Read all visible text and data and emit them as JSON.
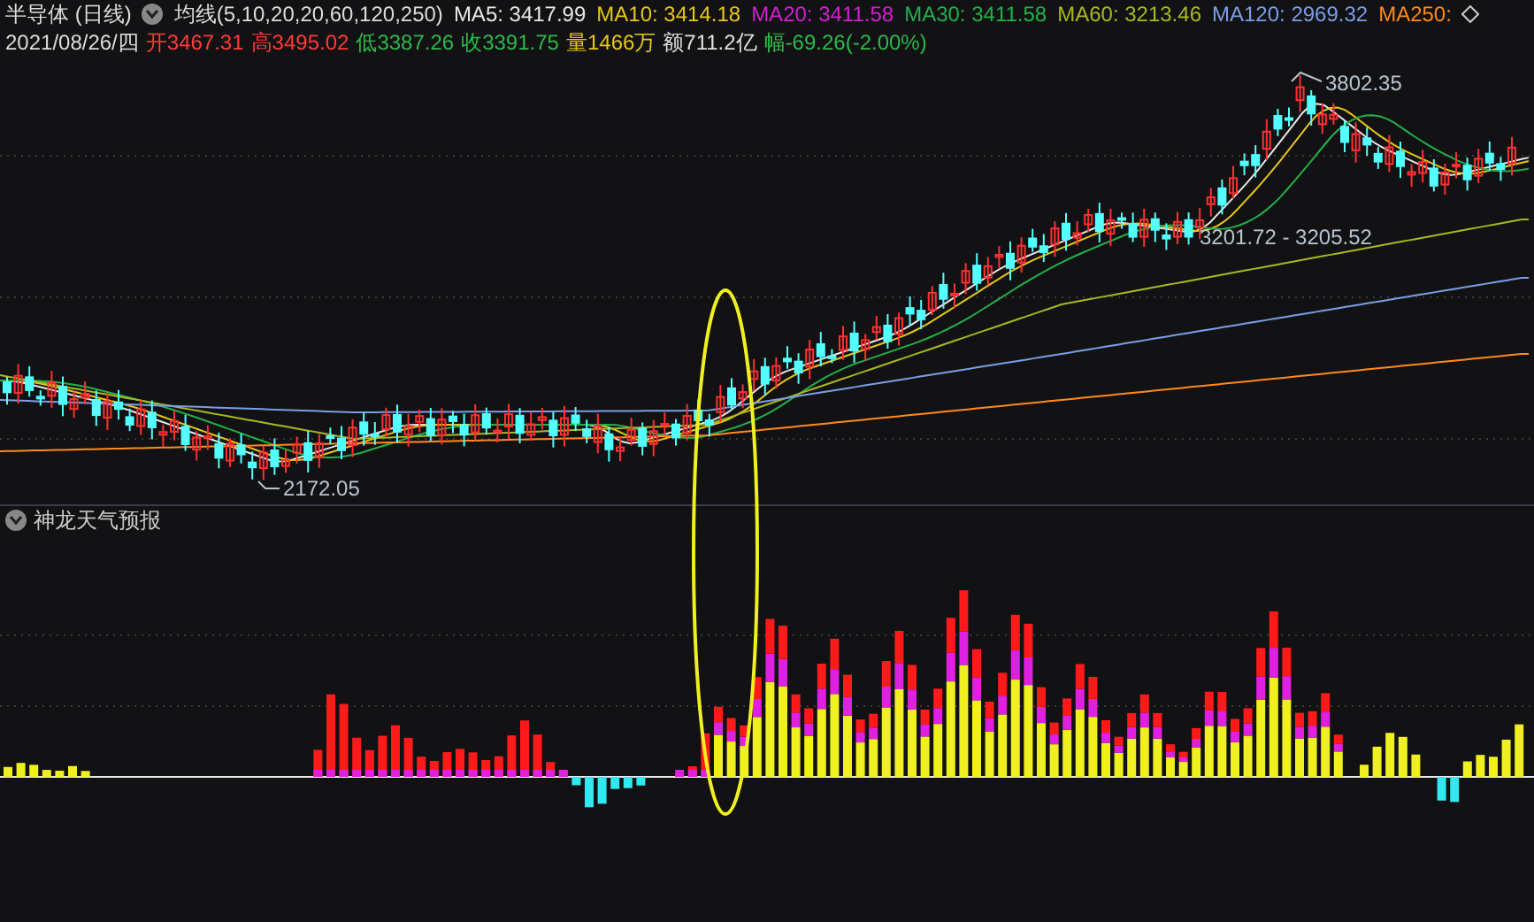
{
  "header": {
    "title": "半导体 (日线)",
    "ma_label": "均线(5,10,20,20,60,120,250)",
    "moving_averages": [
      {
        "label": "MA5: 3417.99",
        "color": "#e8e8e8"
      },
      {
        "label": "MA10: 3414.18",
        "color": "#e6c619"
      },
      {
        "label": "MA20: 3411.58",
        "color": "#d21fd2"
      },
      {
        "label": "MA30: 3411.58",
        "color": "#22b04a"
      },
      {
        "label": "MA60: 3213.46",
        "color": "#a8b820"
      },
      {
        "label": "MA120: 2969.32",
        "color": "#7b9ee6"
      },
      {
        "label": "MA250:",
        "color": "#ff8a1e"
      }
    ]
  },
  "quote": {
    "date": "2021/08/26/四",
    "fields": [
      {
        "label": "开3467.31",
        "color": "#ff3b3b"
      },
      {
        "label": "高3495.02",
        "color": "#ff3b3b"
      },
      {
        "label": "低3387.26",
        "color": "#2fb84a"
      },
      {
        "label": "收3391.75",
        "color": "#2fb84a"
      },
      {
        "label": "量1466万",
        "color": "#e6c619"
      },
      {
        "label": "额711.2亿",
        "color": "#e0e0e0"
      },
      {
        "label": "幅-69.26(-2.00%)",
        "color": "#2fb84a"
      }
    ]
  },
  "price_chart": {
    "annotations": [
      {
        "label": "3802.35"
      },
      {
        "label": "3201.72 - 3205.52"
      },
      {
        "label": "2172.05"
      }
    ]
  },
  "indicator": {
    "title": "神龙天气预报"
  }
}
